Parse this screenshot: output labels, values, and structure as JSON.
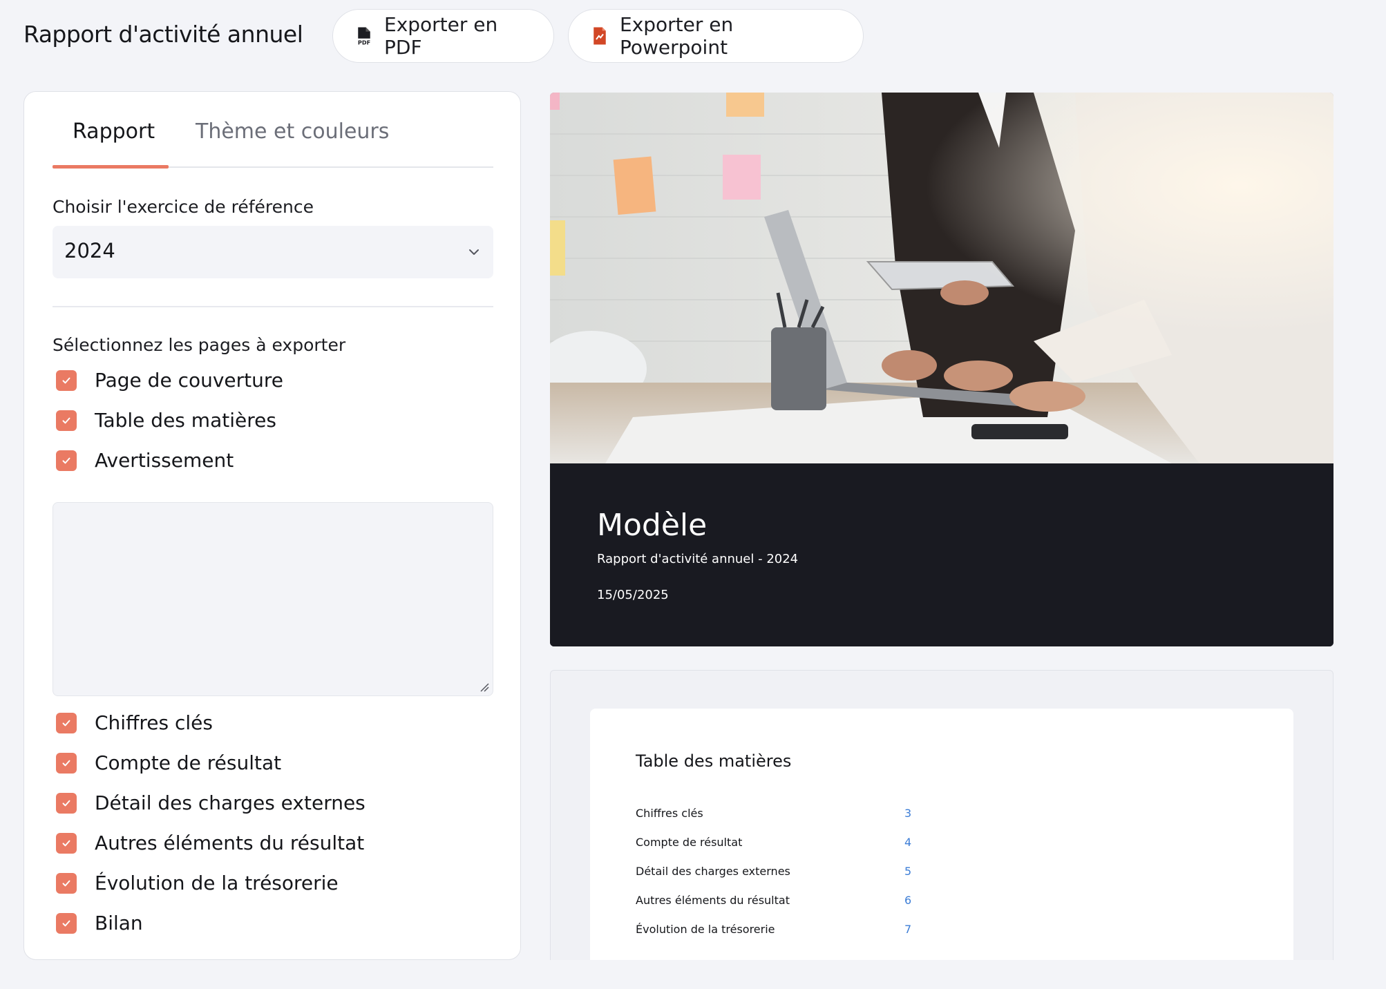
{
  "header": {
    "title": "Rapport d'activité annuel",
    "export_pdf_label": "Exporter en PDF",
    "export_ppt_label": "Exporter en Powerpoint"
  },
  "tabs": [
    {
      "label": "Rapport",
      "active": true
    },
    {
      "label": "Thème et couleurs",
      "active": false
    }
  ],
  "form": {
    "fiscal_year_label": "Choisir l'exercice de référence",
    "fiscal_year_value": "2024",
    "pages_label": "Sélectionnez les pages à exporter",
    "warning_text": ""
  },
  "pages": [
    {
      "label": "Page de couverture",
      "checked": true
    },
    {
      "label": "Table des matières",
      "checked": true
    },
    {
      "label": "Avertissement",
      "checked": true
    },
    {
      "label": "Chiffres clés",
      "checked": true
    },
    {
      "label": "Compte de résultat",
      "checked": true
    },
    {
      "label": "Détail des charges externes",
      "checked": true
    },
    {
      "label": "Autres éléments du résultat",
      "checked": true
    },
    {
      "label": "Évolution de la trésorerie",
      "checked": true
    },
    {
      "label": "Bilan",
      "checked": true
    }
  ],
  "preview": {
    "cover_title": "Modèle",
    "cover_subtitle": "Rapport d'activité annuel - 2024",
    "cover_date": "15/05/2025",
    "toc_title": "Table des matières",
    "toc": [
      {
        "label": "Chiffres clés",
        "page": "3"
      },
      {
        "label": "Compte de résultat",
        "page": "4"
      },
      {
        "label": "Détail des charges externes",
        "page": "5"
      },
      {
        "label": "Autres éléments du résultat",
        "page": "6"
      },
      {
        "label": "Évolution de la trésorerie",
        "page": "7"
      }
    ]
  },
  "colors": {
    "accent": "#ea7a63",
    "background": "#f3f4f8",
    "cover_band": "#191a21",
    "toc_page_number": "#3c7dd6"
  },
  "icons": {
    "export_pdf": "pdf-file-icon",
    "export_ppt": "powerpoint-file-icon",
    "select": "chevron-down-icon",
    "checkbox": "check-icon"
  }
}
